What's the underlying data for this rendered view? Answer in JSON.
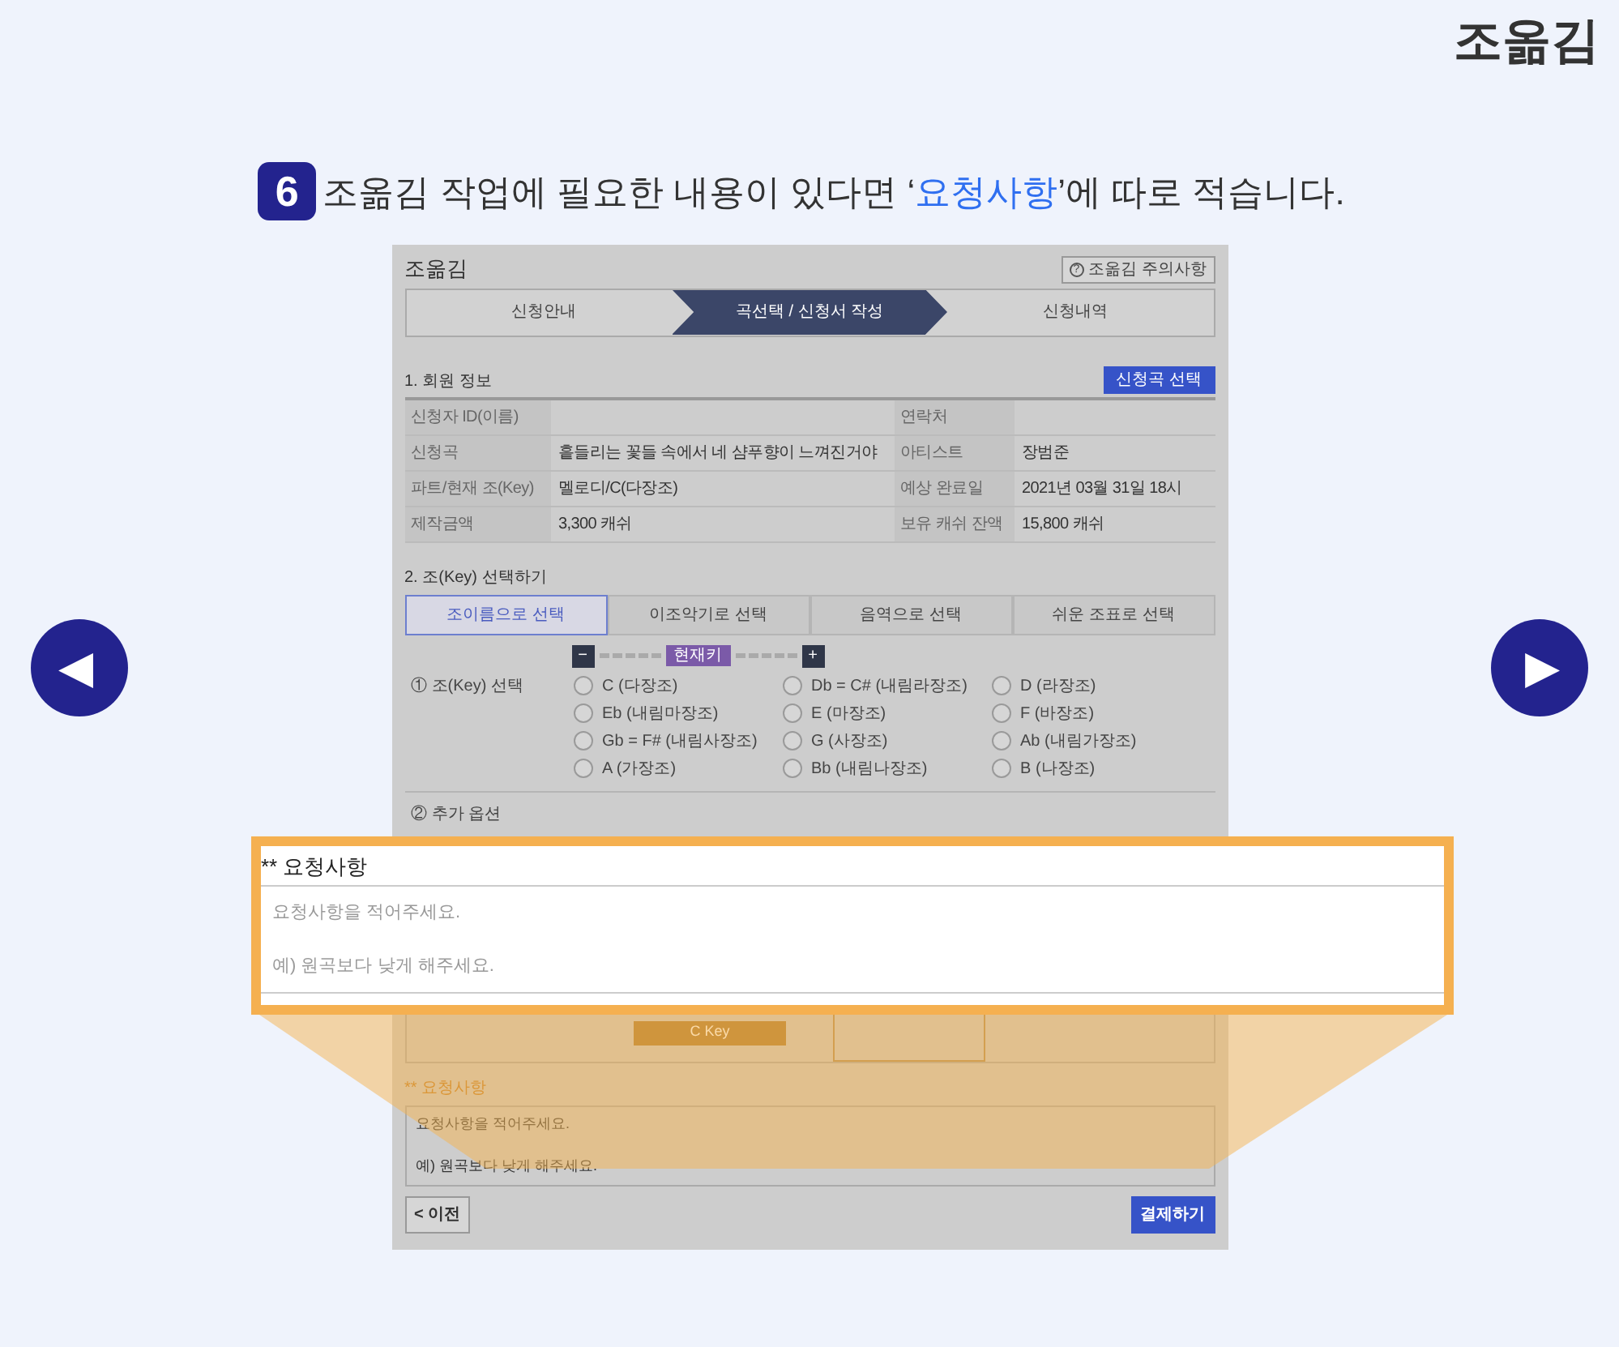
{
  "logo": "조옮김",
  "instruction": {
    "step": "6",
    "text": "조옮김 작업에 필요한 내용이 있다면 ‘**요청사항**’에 따로 적습니다."
  },
  "nav": {
    "prev": "◀",
    "next": "▶"
  },
  "panel": {
    "title": "조옮김",
    "notice_icon": "?",
    "notice_button": "조옮김 주의사항",
    "steps": [
      {
        "label": "신청안내",
        "selected": false
      },
      {
        "label": "곡선택 / 신청서 작성",
        "selected": true
      },
      {
        "label": "신청내역",
        "selected": false
      }
    ],
    "member": {
      "title": "1. 회원 정보",
      "button": "신청곡 선택",
      "rows": [
        {
          "label1": "신청자 ID(이름)",
          "value1": "",
          "label2": "연락처",
          "value2": ""
        },
        {
          "label1": "신청곡",
          "value1": "흩들리는 꽃들 속에서 네 샴푸향이 느껴진거야",
          "label2": "아티스트",
          "value2": "장범준"
        },
        {
          "label1": "파트/현재 조(Key)",
          "value1": "멜로디/C(다장조)",
          "label2": "예상 완료일",
          "value2": "2021년 03월 31일 18시"
        },
        {
          "label1": "제작금액",
          "value1": "3,300 캐쉬",
          "label2": "보유 캐쉬 잔액",
          "value2": "15,800 캐쉬"
        }
      ]
    },
    "key": {
      "title": "2. 조(Key) 선택하기",
      "tabs": [
        {
          "label": "조이름으로 선택",
          "selected": true
        },
        {
          "label": "이조악기로 선택",
          "selected": false
        },
        {
          "label": "음역으로 선택",
          "selected": false
        },
        {
          "label": "쉬운 조표로 선택",
          "selected": false
        }
      ],
      "stepper": {
        "minus": "−",
        "current": "현재키",
        "plus": "+"
      },
      "select_label": "① 조(Key) 선택",
      "options": [
        {
          "label": "C (다장조)",
          "selected": false
        },
        {
          "label": "Db = C# (내림라장조)",
          "selected": false
        },
        {
          "label": "D (라장조)",
          "selected": false
        },
        {
          "label": "Eb (내림마장조)",
          "selected": false
        },
        {
          "label": "E (마장조)",
          "selected": false
        },
        {
          "label": "F (바장조)",
          "selected": false
        },
        {
          "label": "Gb = F# (내림사장조)",
          "selected": false
        },
        {
          "label": "G (사장조)",
          "selected": false
        },
        {
          "label": "Ab (내림가장조)",
          "selected": false
        },
        {
          "label": "A (가장조)",
          "selected": false
        },
        {
          "label": "Bb (내림나장조)",
          "selected": false
        },
        {
          "label": "B (나장조)",
          "selected": false
        }
      ],
      "extra_label": "② 추가 옵션",
      "key_card": "C Key"
    },
    "request": {
      "title": "** 요청사항",
      "lines": [
        "요청사항을 적어주세요.",
        "예) 원곡보다 낮게 해주세요."
      ]
    },
    "prev_button": "< 이전",
    "pay_button": "결제하기"
  },
  "callout": {
    "title": "** 요청사항",
    "lines": [
      "요청사항을 적어주세요.",
      "예) 원곡보다 낮게 해주세요."
    ]
  }
}
